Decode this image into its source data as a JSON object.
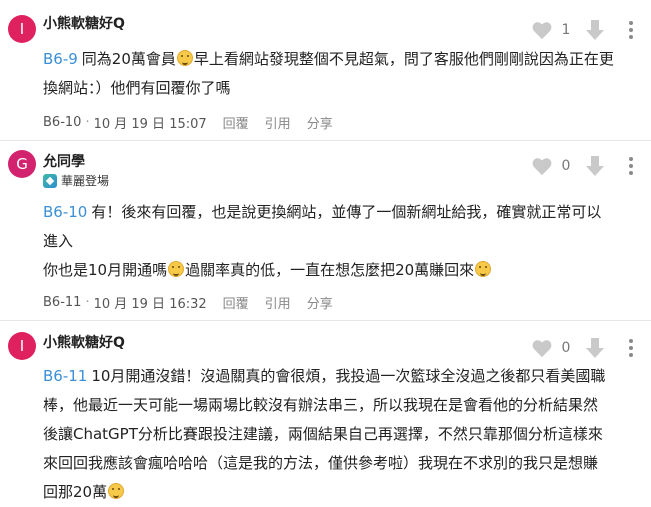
{
  "colors": {
    "avatar_i": "#e0215f",
    "avatar_g": "#d3236e",
    "floor_link": "#3a8fd6"
  },
  "comments": [
    {
      "avatar_letter": "I",
      "author": "小熊軟糖好Q",
      "likes": "1",
      "floor_ref": "B6-9",
      "text_lines": [
        "同為20萬會員",
        "早上看網站發現整個不見超氣，問了客服他們剛剛說因為正在更",
        "換網站：）他們有回覆你了嗎"
      ],
      "floor": "B6-10",
      "date": "10 月 19 日 15:07",
      "actions": [
        "回覆",
        "引用",
        "分享"
      ]
    },
    {
      "avatar_letter": "G",
      "author": "允同學",
      "badge": "華麗登場",
      "likes": "0",
      "floor_ref": "B6-10",
      "text_lines": [
        "有！後來有回覆，也是說更換網站，並傳了一個新網址給我，確實就正常可以",
        "進入",
        "你也是10月開通嗎",
        "過關率真的低，一直在想怎麼把20萬賺回來"
      ],
      "floor": "B6-11",
      "date": "10 月 19 日 16:32",
      "actions": [
        "回覆",
        "引用",
        "分享"
      ]
    },
    {
      "avatar_letter": "I",
      "author": "小熊軟糖好Q",
      "likes": "0",
      "floor_ref": "B6-11",
      "text_lines": [
        "10月開通沒錯！沒過關真的會很煩，我投過一次籃球全沒過之後都只看美國職",
        "棒，他最近一天可能一場兩場比較沒有辦法串三，所以我現在是會看他的分析結果然",
        "後讓ChatGPT分析比賽跟投注建議，兩個結果自己再選擇，不然只靠那個分析這樣來",
        "來回回我應該會瘋哈哈哈（這是我的方法，僅供參考啦）我現在不求別的我只是想賺",
        "回那20萬"
      ]
    }
  ],
  "icons": {
    "like": "heart-icon",
    "dislike": "thumb-down-arrow-icon",
    "more": "more-vertical-icon",
    "badge": "badge-diamond-icon",
    "emoji_grin": "grinning-face-icon",
    "emoji_cold_sweat": "cold-sweat-face-icon",
    "emoji_tired": "tired-face-icon",
    "emoji_weary": "weary-face-icon"
  }
}
